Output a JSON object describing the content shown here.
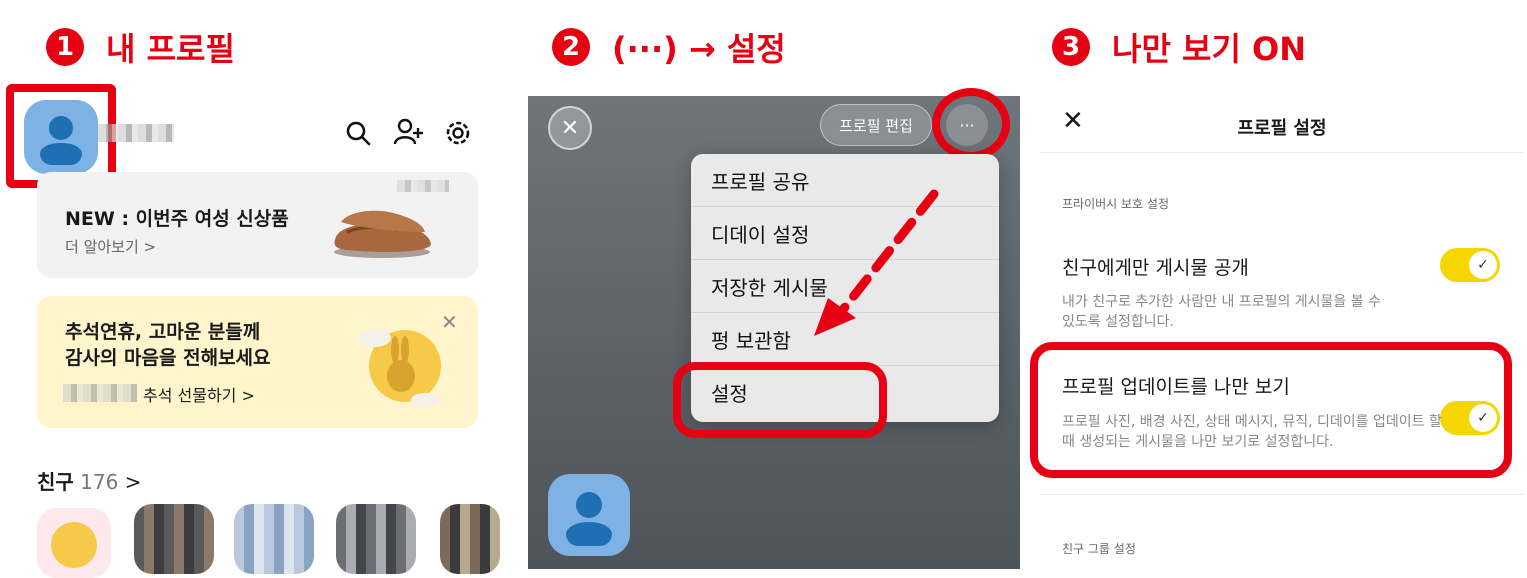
{
  "steps": [
    {
      "number": "1",
      "title": "내 프로필"
    },
    {
      "number": "2",
      "title": "(···) → 설정"
    },
    {
      "number": "3",
      "title": "나만 보기 ON"
    }
  ],
  "panel1": {
    "banner1": {
      "title": "NEW : 이번주 여성 신상품",
      "link": "더 알아보기 >"
    },
    "banner2": {
      "line1": "추석연휴, 고마운 분들께",
      "line2": "감사의 마음을 전해보세요",
      "link": "추석 선물하기 >",
      "close": "✕"
    },
    "friends": {
      "label": "친구",
      "count": "176",
      "chevron": ">"
    },
    "icons": [
      "search-icon",
      "add-friend-icon",
      "settings-icon"
    ]
  },
  "panel2": {
    "edit_button": "프로필 편집",
    "more_button": "···",
    "close": "✕",
    "menu": [
      "프로필 공유",
      "디데이 설정",
      "저장한 게시물",
      "펑 보관함",
      "설정"
    ]
  },
  "panel3": {
    "close": "✕",
    "title": "프로필 설정",
    "section1": "프라이버시 보호 설정",
    "option1": {
      "title": "친구에게만 게시물 공개",
      "desc1": "내가 친구로 추가한 사람만 내 프로필의 게시물을 볼 수",
      "desc2": "있도록 설정합니다.",
      "enabled": true
    },
    "option2": {
      "title": "프로필 업데이트를 나만 보기",
      "desc1": "프로필 사진, 배경 사진, 상태 메시지, 뮤직, 디데이를 업데이트 할",
      "desc2": "때 생성되는 게시물을 나만 보기로 설정합니다.",
      "enabled": true
    },
    "section2": "친구 그룹 설정",
    "check": "✓"
  },
  "colors": {
    "accent_red": "#e60012",
    "toggle_yellow": "#f5d600",
    "avatar_blue": "#7eb2e4"
  }
}
